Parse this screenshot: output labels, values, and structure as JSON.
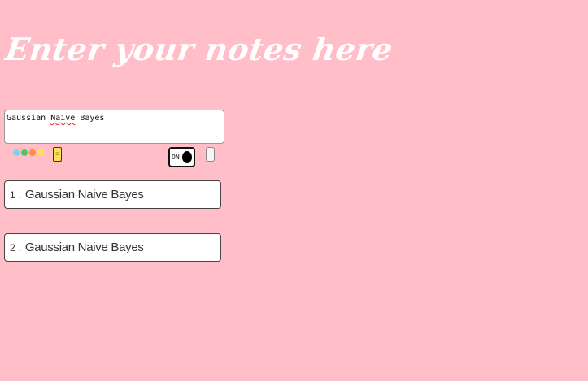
{
  "header": {
    "title": "Enter your notes here"
  },
  "input": {
    "value_before": "Gaussian ",
    "value_misspelled": "Naive",
    "value_after": " Bayes"
  },
  "colors": {
    "background": "#ffbec8",
    "swatches": [
      "#7fd3e6",
      "#4fc85e",
      "#ff8c38",
      "#ffe14d"
    ],
    "sticky": "#ffe14d"
  },
  "controls": {
    "sticky_icon": "note-icon",
    "toggle_label": "ON",
    "toggle_state": "on"
  },
  "notes": [
    {
      "number": "1 .",
      "text": "Gaussian Naive Bayes"
    },
    {
      "number": "2 .",
      "text": "Gaussian Naive Bayes"
    }
  ]
}
